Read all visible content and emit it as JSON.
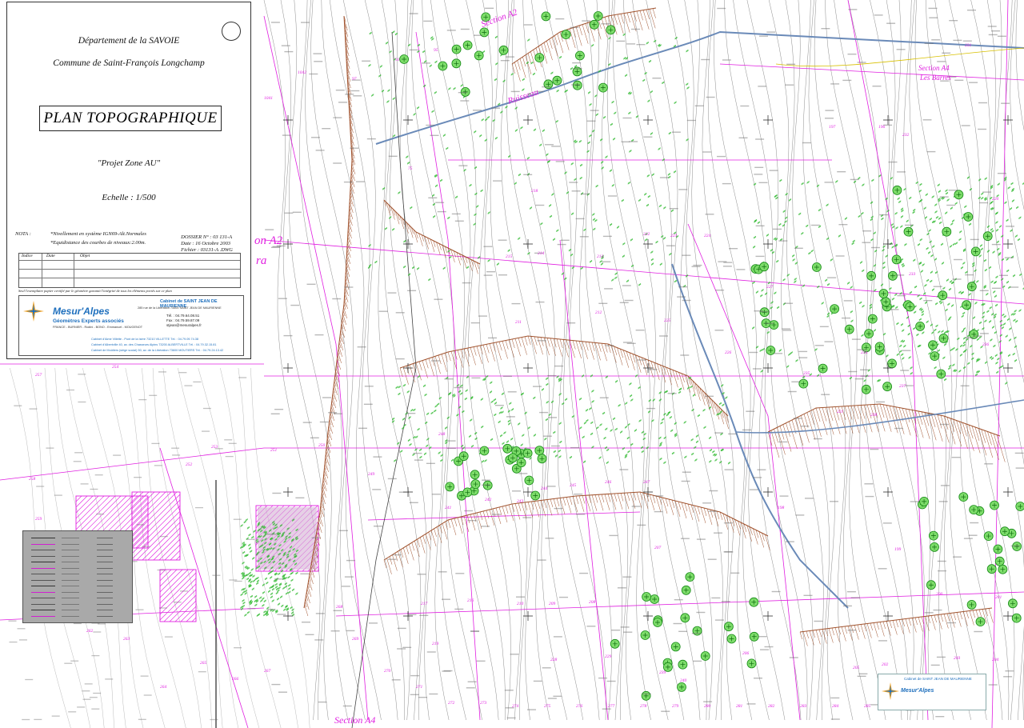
{
  "title_block": {
    "department": "Département de la SAVOIE",
    "commune": "Commune de Saint-François Longchamp",
    "plan_title": "PLAN TOPOGRAPHIQUE",
    "project": "\"Projet Zone AU\"",
    "scale": "Echelle : 1/500",
    "nota_label": "NOTA :",
    "nota_line1": "*Nivellement en système IGN69-Alt.Normales",
    "nota_line2": "*Equidistance des courbes de niveaux:2.00m.",
    "dossier": "DOSSIER N° : 03 131-A",
    "date": "Date : 16 Octobre 2003",
    "fichier": "Fichier : 03131-A .DWG",
    "col_indice": "Indice",
    "col_date": "Date",
    "col_objet": "Objet",
    "disclaimer": "Seul l'exemplaire papier certifié par le géomètre garantit l'intégrité de tous les éléments portés sur ce plan"
  },
  "cartouche": {
    "brand": "Mesur'Alpes",
    "subtitle": "Géomètres Experts associés",
    "partners": "FRANCE - BURNIER - Rodini - BONO - Emmanuel - MOUGENOT",
    "cabinet": "Cabinet de SAINT JEAN DE MAURIENNE",
    "address": "285 rue de la Libération 73300 SAINT JEAN DE MAURIENNE",
    "tel": "Tél. : 04.79.64.08.51",
    "fax": "Fax : 04.79.59.87.09",
    "email": "stjean@mesuralpes.fr",
    "office1": "Cabinet d'Aime Villette - Pont de la Isère 73210 VILLETTE Tél. : 04.79.09.74.38",
    "office2": "Cabinet d'Albertville 40, av. des Chasseurs Alpins 73200 ALBERTVILLE Tél. : 04.79.32.15.81",
    "office3": "Cabinet de Moûtiers (siège social) 50, av. de la Libération 73600 MOUTIERS Tél. : 04.79.24.13.42"
  },
  "stamp": {
    "cabinet": "Cabinet de SAINT JEAN DE MAURIENNE",
    "brand": "Mesur'Alpes"
  },
  "map_labels": {
    "section_a2_top": "Section A2",
    "section_a4_right": "Section A4",
    "les_barres": "Les Barres",
    "ruisseau": "Ruisseau",
    "section_a2_left": "on A2",
    "ra": "ra",
    "section_a4_bottom": "Section A4",
    "parcels": [
      "1042",
      "1041",
      "97",
      "91",
      "95",
      "75",
      "218",
      "215",
      "214",
      "211",
      "212",
      "213",
      "225",
      "222",
      "223",
      "224",
      "227",
      "226",
      "233",
      "234",
      "235",
      "236",
      "237",
      "238",
      "221",
      "220",
      "230",
      "231",
      "232",
      "196",
      "197",
      "198",
      "199",
      "200",
      "201",
      "202",
      "203",
      "204",
      "205",
      "206",
      "207",
      "208",
      "209",
      "210",
      "216",
      "217",
      "219",
      "228",
      "229",
      "239",
      "240",
      "241",
      "242",
      "243",
      "244",
      "245",
      "246",
      "247",
      "248",
      "249",
      "250",
      "251",
      "252",
      "253",
      "254",
      "255",
      "256",
      "257",
      "258",
      "259",
      "260",
      "261",
      "262",
      "263",
      "264",
      "265",
      "266",
      "267",
      "268",
      "269",
      "270",
      "271",
      "272",
      "273",
      "274",
      "275",
      "276",
      "277",
      "278",
      "279",
      "280",
      "281",
      "282",
      "283",
      "284",
      "285",
      "286",
      "287",
      "288",
      "289",
      "290",
      "291",
      "292",
      "293",
      "294",
      "295",
      "296",
      "297",
      "298",
      "299",
      "300"
    ]
  },
  "colors": {
    "magenta": "#e020e0",
    "green": "#2db82d",
    "brown": "#a0522d",
    "contour": "#555555",
    "blue": "#1e6fbd"
  }
}
